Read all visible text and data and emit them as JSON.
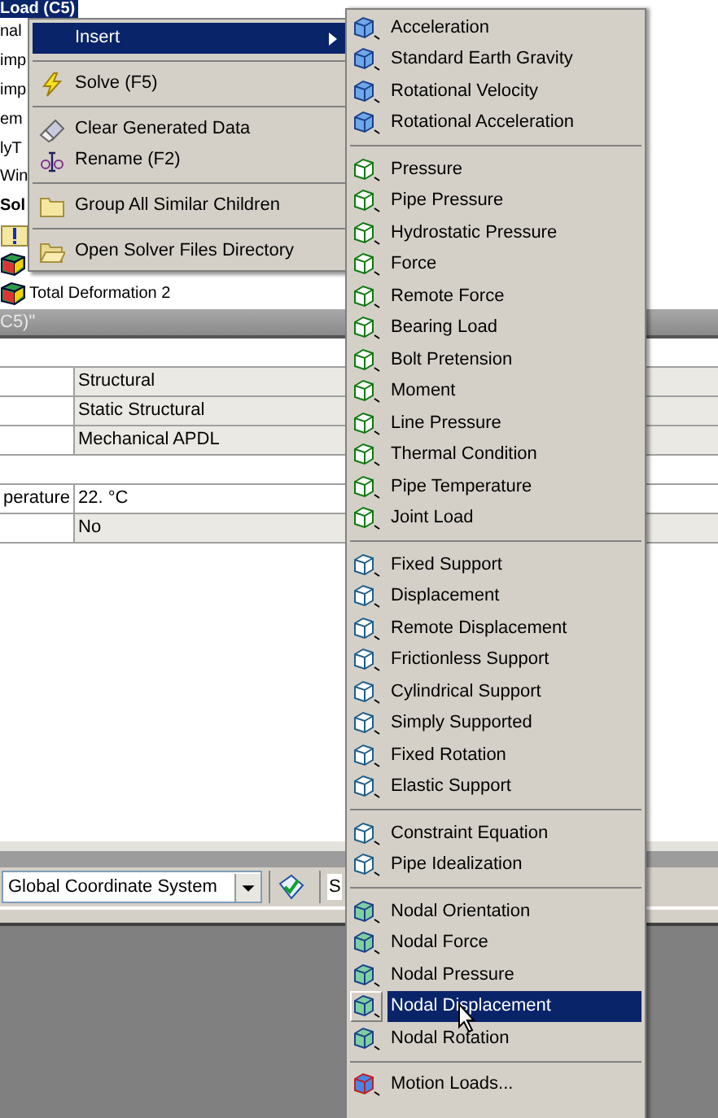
{
  "tree": {
    "title": "Load (C5)",
    "rows": [
      {
        "kind": "text",
        "label": "nal",
        "bold": false
      },
      {
        "kind": "text",
        "label": "imp",
        "bold": false
      },
      {
        "kind": "text",
        "label": "imp",
        "bold": false
      },
      {
        "kind": "text",
        "label": "em",
        "bold": false
      },
      {
        "kind": "text",
        "label": "lyT",
        "bold": false
      },
      {
        "kind": "text",
        "label": "Win",
        "bold": false
      },
      {
        "kind": "text",
        "label": "Sol",
        "bold": true
      },
      {
        "kind": "info"
      },
      {
        "kind": "result"
      },
      {
        "kind": "result",
        "label": "Total Deformation 2"
      }
    ]
  },
  "details": {
    "header": "C5)\"",
    "rows": [
      {
        "kind": "group"
      },
      {
        "kind": "row",
        "value": "Structural",
        "shaded": true
      },
      {
        "kind": "row",
        "value": "Static Structural",
        "shaded": true
      },
      {
        "kind": "row",
        "value": "Mechanical APDL",
        "shaded": true
      },
      {
        "kind": "group"
      },
      {
        "kind": "row",
        "label": "perature",
        "value": "22. °C",
        "shaded": false
      },
      {
        "kind": "row",
        "value": "No",
        "shaded": true
      }
    ]
  },
  "toolbar": {
    "coordinate_system": "Global Coordinate System",
    "label": "S"
  },
  "context_menu": {
    "groups": [
      [
        {
          "label": "Insert",
          "submenu": true,
          "selected": true
        }
      ],
      [
        {
          "label": "Solve (F5)",
          "submenu": false,
          "selected": false
        }
      ],
      [
        {
          "label": "Clear Generated Data",
          "submenu": false,
          "selected": false
        },
        {
          "label": "Rename (F2)",
          "submenu": false,
          "selected": false
        }
      ],
      [
        {
          "label": "Group All Similar Children",
          "submenu": false,
          "selected": false
        }
      ],
      [
        {
          "label": "Open Solver Files Directory",
          "submenu": false,
          "selected": false
        }
      ]
    ]
  },
  "insert_menu": {
    "groups": [
      [
        {
          "label": "Acceleration",
          "selected": false
        },
        {
          "label": "Standard Earth Gravity",
          "selected": false
        },
        {
          "label": "Rotational Velocity",
          "selected": false
        },
        {
          "label": "Rotational Acceleration",
          "selected": false
        }
      ],
      [
        {
          "label": "Pressure",
          "selected": false
        },
        {
          "label": "Pipe Pressure",
          "selected": false
        },
        {
          "label": "Hydrostatic Pressure",
          "selected": false
        },
        {
          "label": "Force",
          "selected": false
        },
        {
          "label": "Remote Force",
          "selected": false
        },
        {
          "label": "Bearing Load",
          "selected": false
        },
        {
          "label": "Bolt Pretension",
          "selected": false
        },
        {
          "label": "Moment",
          "selected": false
        },
        {
          "label": "Line Pressure",
          "selected": false
        },
        {
          "label": "Thermal Condition",
          "selected": false
        },
        {
          "label": "Pipe Temperature",
          "selected": false
        },
        {
          "label": "Joint Load",
          "selected": false
        }
      ],
      [
        {
          "label": "Fixed Support",
          "selected": false
        },
        {
          "label": "Displacement",
          "selected": false
        },
        {
          "label": "Remote Displacement",
          "selected": false
        },
        {
          "label": "Frictionless Support",
          "selected": false
        },
        {
          "label": "Cylindrical Support",
          "selected": false
        },
        {
          "label": "Simply Supported",
          "selected": false
        },
        {
          "label": "Fixed Rotation",
          "selected": false
        },
        {
          "label": "Elastic Support",
          "selected": false
        }
      ],
      [
        {
          "label": "Constraint Equation",
          "selected": false
        },
        {
          "label": "Pipe Idealization",
          "selected": false
        }
      ],
      [
        {
          "label": "Nodal Orientation",
          "selected": false
        },
        {
          "label": "Nodal Force",
          "selected": false
        },
        {
          "label": "Nodal Pressure",
          "selected": false
        },
        {
          "label": "Nodal Displacement",
          "selected": true
        },
        {
          "label": "Nodal Rotation",
          "selected": false
        }
      ],
      [
        {
          "label": "Motion Loads...",
          "selected": false
        }
      ]
    ]
  }
}
